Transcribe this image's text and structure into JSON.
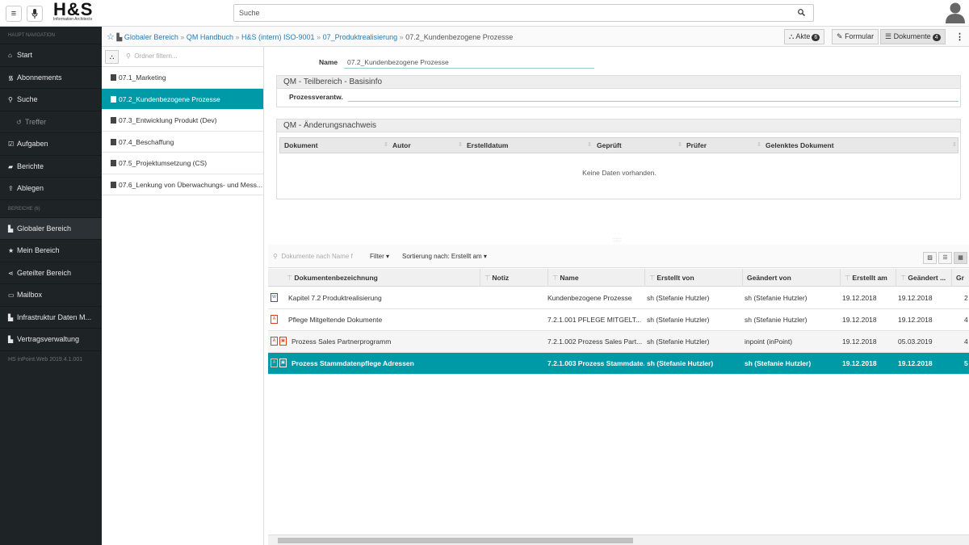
{
  "topbar": {
    "menu_icon": "hamburger-icon",
    "mic_icon": "microphone-icon",
    "logo_text": "H&S",
    "logo_sub": "Information Architects",
    "search_placeholder": "Suche",
    "search_icon": "search-icon",
    "user_icon": "user-icon"
  },
  "sidebar": {
    "header_nav": "HAUPT NAVIGATION",
    "nav": [
      {
        "icon": "home-icon",
        "label": "Start"
      },
      {
        "icon": "rss-icon",
        "label": "Abonnements"
      },
      {
        "icon": "search-icon",
        "label": "Suche"
      },
      {
        "icon": "history-icon",
        "label": "Treffer"
      },
      {
        "icon": "check-icon",
        "label": "Aufgaben"
      },
      {
        "icon": "book-icon",
        "label": "Berichte"
      },
      {
        "icon": "upload-icon",
        "label": "Ablegen"
      }
    ],
    "header_areas": "BEREICHE (6)",
    "areas": [
      {
        "icon": "building-icon",
        "label": "Globaler Bereich"
      },
      {
        "icon": "star-icon",
        "label": "Mein Bereich"
      },
      {
        "icon": "share-icon",
        "label": "Geteilter Bereich"
      },
      {
        "icon": "inbox-icon",
        "label": "Mailbox"
      },
      {
        "icon": "building-icon",
        "label": "Infrastruktur Daten M..."
      },
      {
        "icon": "building-icon",
        "label": "Vertragsverwaltung"
      }
    ],
    "version": "HS  inPoint.Web 2019.4.1.001"
  },
  "breadcrumb": {
    "items": [
      "Globaler Bereich",
      "QM Handbuch",
      "H&S (intern) ISO-9001",
      "07_Produktrealisierung"
    ],
    "separator": "»",
    "current": "07.2_Kundenbezogene Prozesse"
  },
  "view_tabs": {
    "akte": {
      "label": "Akte",
      "badge": "6"
    },
    "formular": {
      "label": "Formular"
    },
    "dokumente": {
      "label": "Dokumente",
      "badge": "4"
    }
  },
  "folders": {
    "filter_placeholder": "Ordner filtern...",
    "items": [
      "07.1_Marketing",
      "07.2_Kundenbezogene Prozesse",
      "07.3_Entwicklung Produkt (Dev)",
      "07.4_Beschaffung",
      "07.5_Projektumsetzung (CS)",
      "07.6_Lenkung von Überwachungs- und Mess..."
    ],
    "selected_index": 1
  },
  "form": {
    "name_label": "Name",
    "name_value": "07.2_Kundenbezogene Prozesse",
    "section1_title": "QM - Teilbereich - Basisinfo",
    "prozess_label": "Prozessverantw.",
    "section2_title": "QM - Änderungsnachweis",
    "columns": [
      "Dokument",
      "Autor",
      "Erstelldatum",
      "Geprüft",
      "Prüfer",
      "Gelenktes Dokument"
    ],
    "empty_text": "Keine Daten vorhanden."
  },
  "documents": {
    "search_placeholder": "Dokumente nach Name f",
    "filter_label": "Filter ▾",
    "sort_label": "Sortierung nach: Erstellt am ▾",
    "columns": [
      "Dokumentenbezeichnung",
      "Notiz",
      "Name",
      "Erstellt von",
      "Geändert von",
      "Erstellt am",
      "Geändert ...",
      "Gr"
    ],
    "rows": [
      {
        "bezeichnung": "Kapitel 7.2 Produktrealisierung",
        "notiz": "",
        "name": "Kundenbezogene Prozesse",
        "erstellt_von": "sh (Stefanie Hutzler)",
        "geaendert_von": "sh (Stefanie Hutzler)",
        "erstellt_am": "19.12.2018",
        "geaendert_am": "19.12.2018",
        "gr": "2",
        "icon": "word-file-icon"
      },
      {
        "bezeichnung": "Pflege Mitgeltende Dokumente",
        "notiz": "",
        "name": "7.2.1.001 PFLEGE MITGELT...",
        "erstellt_von": "sh (Stefanie Hutzler)",
        "geaendert_von": "sh (Stefanie Hutzler)",
        "erstellt_am": "19.12.2018",
        "geaendert_am": "19.12.2018",
        "gr": "4",
        "icon": "pdf-file-icon"
      },
      {
        "bezeichnung": "Prozess Sales Partnerprogramm",
        "notiz": "",
        "name": "7.2.1.002 Prozess Sales Part...",
        "erstellt_von": "sh (Stefanie Hutzler)",
        "geaendert_von": "inpoint (inPoint)",
        "erstellt_am": "19.12.2018",
        "geaendert_am": "05.03.2019",
        "gr": "4",
        "icon": "pdf-file-icon"
      },
      {
        "bezeichnung": "Prozess Stammdatenpflege Adressen",
        "notiz": "",
        "name": "7.2.1.003 Prozess Stammdate...",
        "erstellt_von": "sh (Stefanie Hutzler)",
        "geaendert_von": "sh (Stefanie Hutzler)",
        "erstellt_am": "19.12.2018",
        "geaendert_am": "19.12.2018",
        "gr": "5",
        "icon": "pdf-file-icon"
      }
    ],
    "selected_index": 3
  },
  "colors": {
    "accent": "#0099a8",
    "sidebar_bg": "#1e2326",
    "link": "#2a7ab0"
  }
}
